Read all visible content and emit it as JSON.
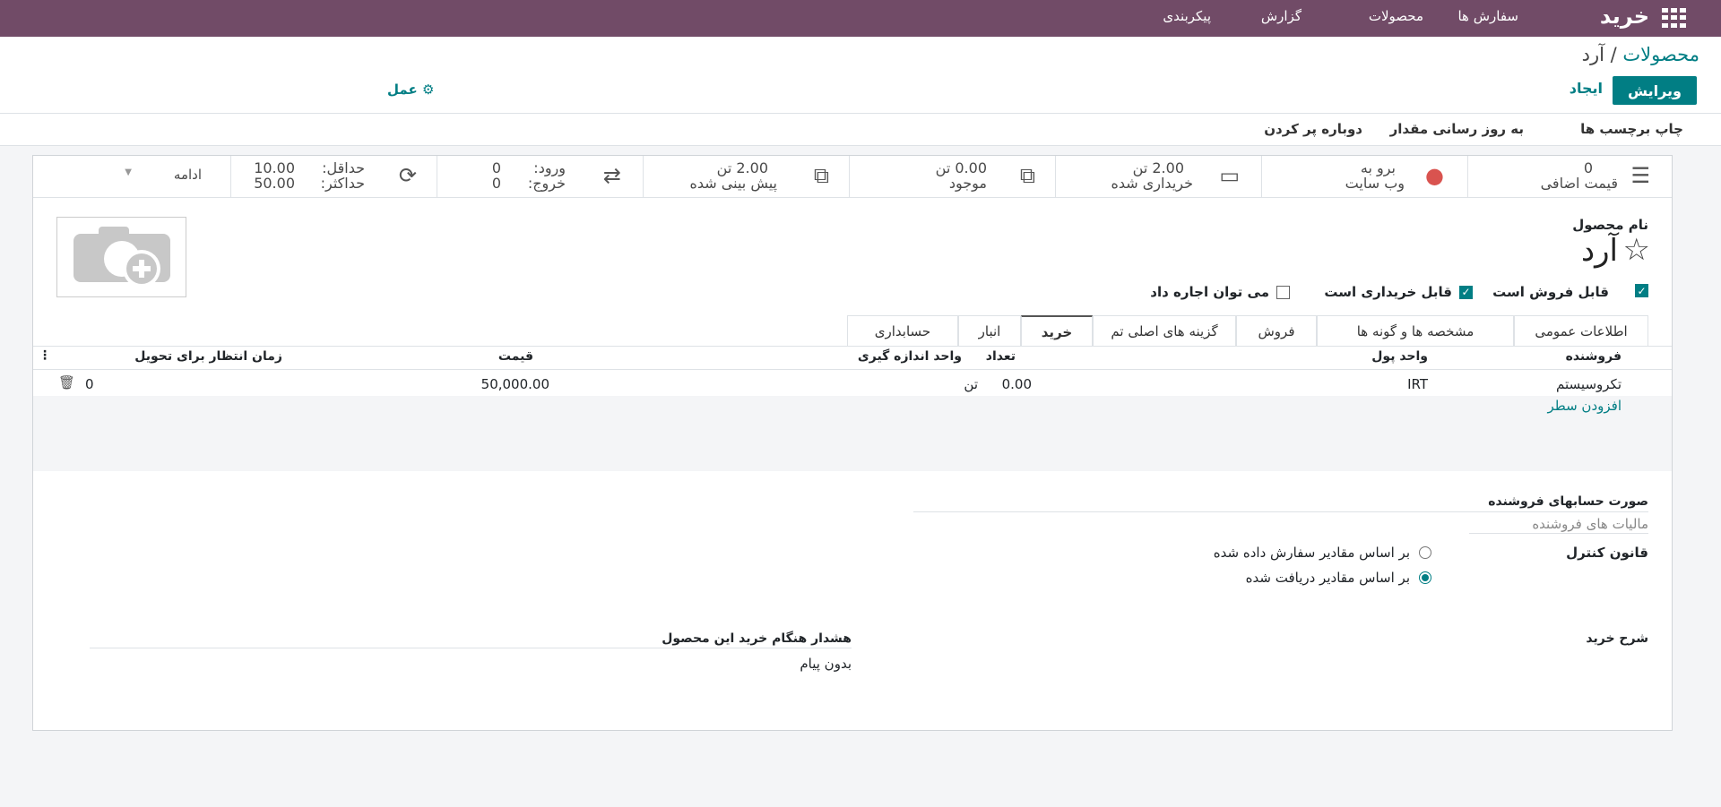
{
  "navbar": {
    "app_name": "خرید",
    "menus": [
      "سفارش ها",
      "محصولات",
      "گزارش",
      "پیکربندی"
    ]
  },
  "breadcrumb": {
    "parent": "محصولات",
    "separator": "/",
    "current": "آرد"
  },
  "control": {
    "edit_label": "ویرایش",
    "create_label": "ایجاد",
    "action_label": "عمل"
  },
  "status_actions": [
    "چاپ برچسب ها",
    "به روز رسانی مقدار",
    "دوباره پر کردن"
  ],
  "smart_buttons": {
    "extra_price": {
      "value": "0",
      "label": "قیمت اضافی"
    },
    "website": {
      "line1": "برو به",
      "line2": "وب سایت"
    },
    "purchased": {
      "value": "2.00 تن",
      "label": "خریداری شده"
    },
    "on_hand": {
      "value": "0.00 تن",
      "label": "موجود"
    },
    "forecast": {
      "value": "2.00 تن",
      "label": "پیش بینی شده"
    },
    "moves": {
      "in_label": "ورود:",
      "in_value": "0",
      "out_label": "خروج:",
      "out_value": "0"
    },
    "reorder": {
      "min_label": "حداقل:",
      "min_value": "10.00",
      "max_label": "حداکثر:",
      "max_value": "50.00"
    },
    "more": "ادامه"
  },
  "product": {
    "name_label": "نام محصول",
    "name": "آرد",
    "checks": [
      {
        "label": "قابل فروش است",
        "checked": true
      },
      {
        "label": "قابل خریداری است",
        "checked": false
      },
      {
        "label": "می توان اجاره داد",
        "checked": false
      }
    ]
  },
  "tabs": [
    "اطلاعات عمومی",
    "مشخصه ها و گونه ها",
    "فروش",
    "گزینه های اصلی تم",
    "خرید",
    "انبار",
    "حسابداری"
  ],
  "active_tab": "خرید",
  "vendor_table": {
    "headers": {
      "vendor": "فروشنده",
      "currency": "واحد پول",
      "quantity": "تعداد",
      "uom": "واحد اندازه گیری",
      "price": "قیمت",
      "delay": "زمان انتظار برای تحویل"
    },
    "rows": [
      {
        "vendor": "تکروسیستم",
        "currency": "IRT",
        "quantity": "0.00",
        "uom": "تن",
        "price": "50,000.00",
        "delay": "0"
      }
    ],
    "add_line": "افزودن سطر"
  },
  "purchase": {
    "bills_label": "صورت حسابهای فروشنده",
    "taxes_placeholder": "مالیات های فروشنده",
    "control_policy_label": "قانون کنترل",
    "policy_options": [
      {
        "label": "بر اساس مقادیر سفارش داده شده",
        "selected": false
      },
      {
        "label": "بر اساس مقادیر دریافت شده",
        "selected": true
      }
    ],
    "description_label": "شرح خرید",
    "warning_label": "هشدار هنگام خرید این محصول",
    "warning_value": "بدون پیام"
  },
  "colors": {
    "navbar": "#714b67",
    "primary": "#017e84"
  }
}
